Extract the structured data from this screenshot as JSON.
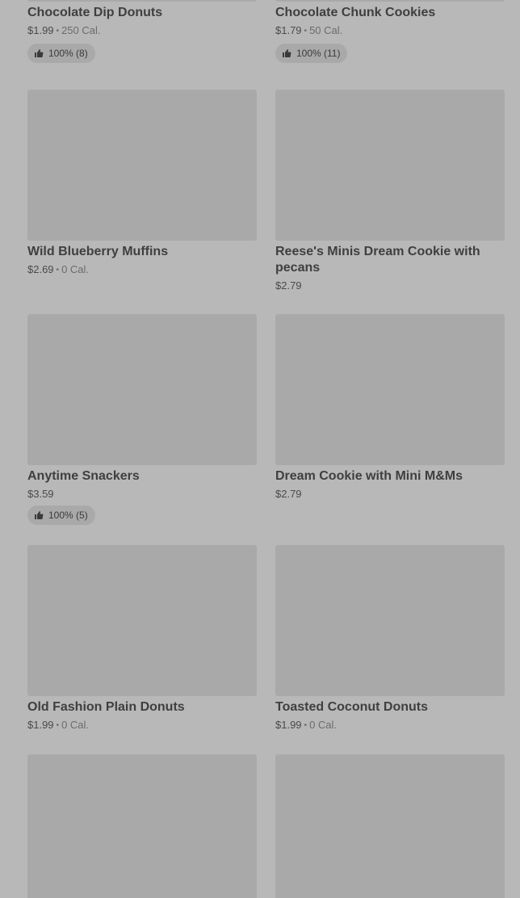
{
  "items": [
    {
      "name": "Chocolate Dip Donuts",
      "price": "$1.99",
      "separator": "•",
      "calories": "250 Cal.",
      "rating": "100% (8)",
      "icon": "thumbs-up-icon"
    },
    {
      "name": "Chocolate Chunk Cookies",
      "price": "$1.79",
      "separator": "•",
      "calories": "50 Cal.",
      "rating": "100% (11)",
      "icon": "thumbs-up-icon"
    },
    {
      "name": "Wild Blueberry Muffins",
      "price": "$2.69",
      "separator": "•",
      "calories": "0 Cal."
    },
    {
      "name": "Reese's Minis Dream Cookie with pecans",
      "price": "$2.79"
    },
    {
      "name": "Anytime Snackers",
      "price": "$3.59",
      "rating": "100% (5)",
      "icon": "thumbs-up-icon"
    },
    {
      "name": "Dream Cookie with Mini M&Ms",
      "price": "$2.79"
    },
    {
      "name": "Old Fashion Plain Donuts",
      "price": "$1.99",
      "separator": "•",
      "calories": "0 Cal."
    },
    {
      "name": "Toasted Coconut Donuts",
      "price": "$1.99",
      "separator": "•",
      "calories": "0 Cal."
    }
  ],
  "colors": {
    "page_background": "#b8b8b8",
    "image_placeholder": "#a9a9a9",
    "text": "#3f3f3f"
  }
}
